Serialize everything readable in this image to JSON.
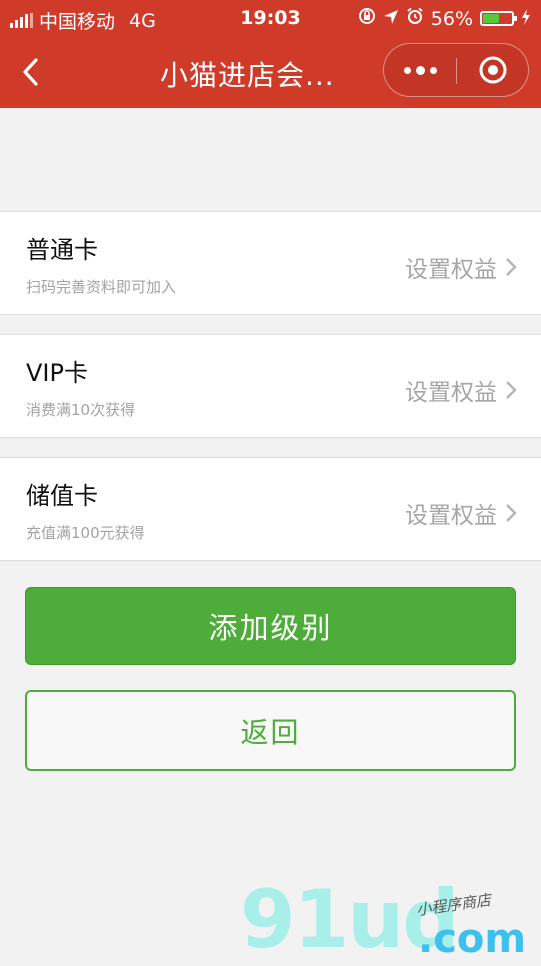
{
  "status_bar": {
    "carrier": "中国移动",
    "network": "4G",
    "time": "19:03",
    "battery_percent": "56%",
    "battery_level": 0.56
  },
  "navbar": {
    "title": "小猫进店会..."
  },
  "cards": [
    {
      "name": "普通卡",
      "desc": "扫码完善资料即可加入",
      "action": "设置权益"
    },
    {
      "name": "VIP卡",
      "desc": "消费满10次获得",
      "action": "设置权益"
    },
    {
      "name": "储值卡",
      "desc": "充值满100元获得",
      "action": "设置权益"
    }
  ],
  "buttons": {
    "add_label": "添加级别",
    "back_label": "返回"
  },
  "watermark": {
    "logo": "91ud",
    "domain": ".com",
    "tagline": "小程序商店"
  },
  "colors": {
    "header": "#d03a28",
    "primary_green": "#4dac3a",
    "background": "#f2f2f2"
  }
}
